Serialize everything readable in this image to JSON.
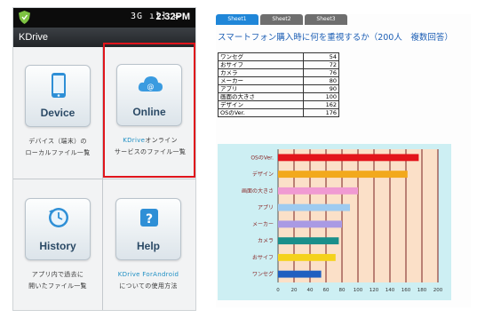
{
  "phone": {
    "status_icons": "3G ıll ▭",
    "time": "2:32PM",
    "app_title": "KDrive",
    "tiles": [
      {
        "label": "Device",
        "desc_lines": [
          "デバイス（端末）の",
          "ローカルファイル一覧"
        ],
        "icon": "phone-icon",
        "selected": false
      },
      {
        "label": "Online",
        "desc_lines": [
          "KDriveオンライン",
          "サービスのファイル一覧"
        ],
        "accent_prefix": "KDrive",
        "icon": "cloud-icon",
        "selected": true
      },
      {
        "label": "History",
        "desc_lines": [
          "アプリ内で過去に",
          "開いたファイル一覧"
        ],
        "icon": "clock-icon",
        "selected": false
      },
      {
        "label": "Help",
        "desc_lines": [
          "KDrive ForAndroid",
          "についての使用方法"
        ],
        "accent_prefix": "KDrive ForAndroid",
        "icon": "help-icon",
        "selected": false
      }
    ]
  },
  "sheet": {
    "tabs": [
      "Sheet1",
      "Sheet2",
      "Sheet3"
    ],
    "active_tab": 0,
    "title": "スマートフォン購入時に何を重視するか（200人　複数回答）",
    "table": [
      [
        "ワンセグ",
        "54"
      ],
      [
        "おサイフ",
        "72"
      ],
      [
        "カメラ",
        "76"
      ],
      [
        "メーカー",
        "80"
      ],
      [
        "アプリ",
        "90"
      ],
      [
        "画面の大きさ",
        "100"
      ],
      [
        "デザイン",
        "162"
      ],
      [
        "OSのVer.",
        "176"
      ]
    ]
  },
  "chart_data": {
    "type": "bar",
    "orientation": "horizontal",
    "categories": [
      "ワンセグ",
      "おサイフ",
      "カメラ",
      "メーカー",
      "アプリ",
      "画面の大きさ",
      "デザイン",
      "OSのVer."
    ],
    "values": [
      54,
      72,
      76,
      80,
      90,
      100,
      162,
      176
    ],
    "bar_colors": [
      "#1f5fc0",
      "#f4d21c",
      "#1a8f8a",
      "#a99ae4",
      "#9ecbf0",
      "#f09ad2",
      "#f2a91c",
      "#e3141b"
    ],
    "xlim": [
      0,
      200
    ],
    "xticks": [
      0,
      20,
      40,
      60,
      80,
      100,
      120,
      140,
      160,
      180,
      200
    ],
    "grid": true,
    "plot_bg": "#fbe0c8",
    "title": "",
    "xlabel": "",
    "ylabel": ""
  },
  "colors": {
    "selection_border": "#e0141b",
    "accent_text": "#1e8fc4",
    "sheet_title": "#1d5fb5"
  }
}
